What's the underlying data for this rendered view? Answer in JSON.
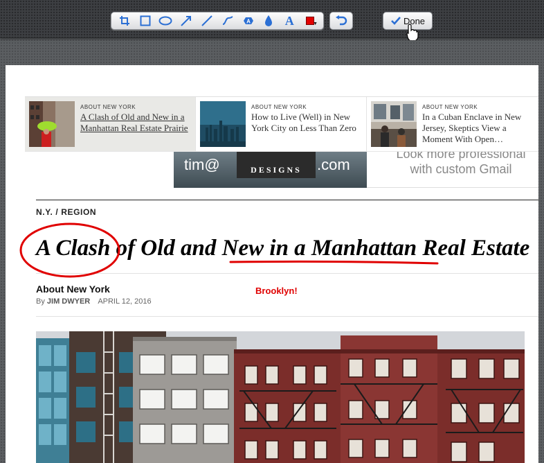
{
  "toolbar": {
    "tools": [
      {
        "name": "crop-tool-icon"
      },
      {
        "name": "rectangle-tool-icon"
      },
      {
        "name": "ellipse-tool-icon"
      },
      {
        "name": "arrow-tool-icon"
      },
      {
        "name": "line-tool-icon"
      },
      {
        "name": "freehand-tool-icon"
      },
      {
        "name": "stamp-tool-icon"
      },
      {
        "name": "blur-tool-icon"
      },
      {
        "name": "text-tool-icon",
        "glyph": "A"
      },
      {
        "name": "color-picker-icon",
        "color": "#e20000"
      }
    ],
    "done_label": "Done",
    "accent": "#2b6fd4"
  },
  "related": [
    {
      "kicker": "ABOUT NEW YORK",
      "title": "A Clash of Old and New in a Manhattan Real Estate Prairie",
      "active": true
    },
    {
      "kicker": "ABOUT NEW YORK",
      "title": "How to Live (Well) in New York City on Less Than Zero",
      "active": false
    },
    {
      "kicker": "ABOUT NEW YORK",
      "title": "In a Cuban Enclave in New Jersey, Skeptics View a Moment With Open…",
      "active": false
    }
  ],
  "ad": {
    "email": "tim@",
    "logo": "DESIGNS",
    "domain": ".com",
    "right_line1": "Look more professional",
    "right_line2": "with custom Gmail"
  },
  "article": {
    "section": "N.Y.  /  REGION",
    "headline": "A Clash of Old and New in a Manhattan Real Estate",
    "column": "About New York",
    "byline_prefix": "By",
    "author": "JIM DWYER",
    "date": "APRIL 12, 2016"
  },
  "annotation": {
    "text": "Brooklyn!",
    "color": "#e00000"
  }
}
